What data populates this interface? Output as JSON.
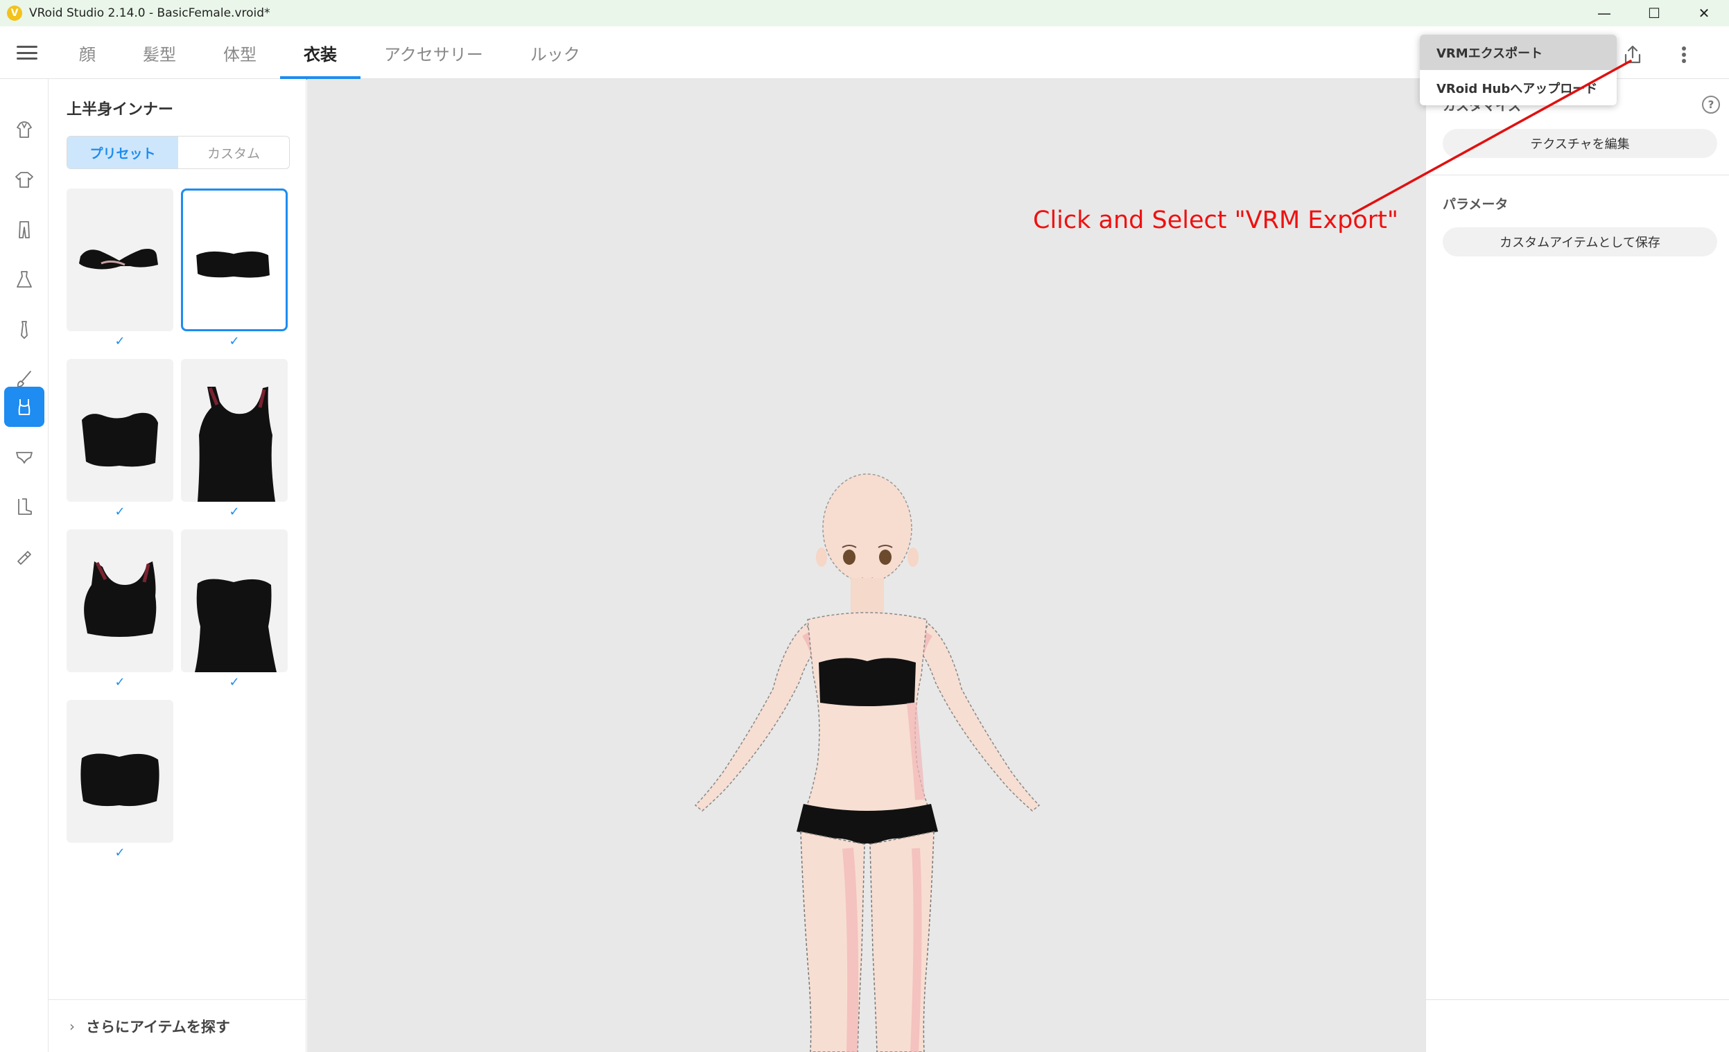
{
  "window": {
    "title": "VRoid Studio 2.14.0 - BasicFemale.vroid*",
    "logo_glyph": "V",
    "minimize": "—",
    "maximize": "☐",
    "close": "✕"
  },
  "tabs": [
    {
      "label": "顔",
      "active": false
    },
    {
      "label": "髪型",
      "active": false
    },
    {
      "label": "体型",
      "active": false
    },
    {
      "label": "衣装",
      "active": true
    },
    {
      "label": "アクセサリー",
      "active": false
    },
    {
      "label": "ルック",
      "active": false
    }
  ],
  "export_menu": {
    "items": [
      {
        "label": "VRMエクスポート",
        "highlighted": true
      },
      {
        "label": "VRoid Hubへアップロード",
        "highlighted": false
      }
    ]
  },
  "sidebar_icons": [
    "hood-icon",
    "shirt-icon",
    "pants-icon",
    "dress-icon",
    "tie-icon",
    "brush-icon",
    "inner-top-icon",
    "inner-bottom-icon",
    "boots-icon",
    "accessory-icon"
  ],
  "left_panel": {
    "title": "上半身インナー",
    "segments": {
      "preset": "プリセット",
      "custom": "カスタム"
    },
    "check_glyph": "✓",
    "find_more": "さらにアイテムを探す",
    "find_more_chevron": "›"
  },
  "right_panel": {
    "customize_title": "カスタマイズ",
    "help_glyph": "?",
    "edit_texture": "テクスチャを編集",
    "parameters_title": "パラメータ",
    "save_custom": "カスタムアイテムとして保存"
  },
  "annotation": {
    "text": "Click and Select \"VRM Export\"",
    "color": "#e01010"
  },
  "colors": {
    "accent": "#1e8cf0",
    "titlebar": "#eaf6e9",
    "viewport": "#e8e8e8"
  }
}
